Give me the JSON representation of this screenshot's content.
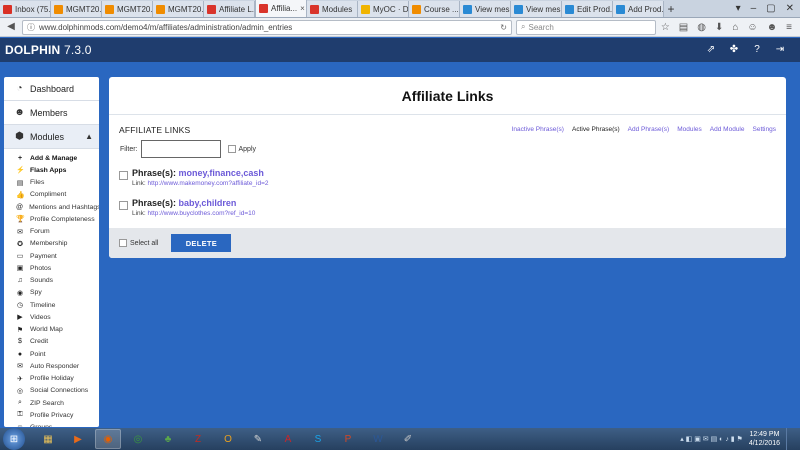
{
  "browser": {
    "tabs": [
      {
        "label": "Inbox (75...",
        "icon": "gmail-icon",
        "color": "#d93025"
      },
      {
        "label": "MGMT20...",
        "icon": "moodle-icon",
        "color": "#f08c00"
      },
      {
        "label": "MGMT20...",
        "icon": "moodle-icon",
        "color": "#f08c00"
      },
      {
        "label": "MGMT20...",
        "icon": "moodle-icon",
        "color": "#f08c00"
      },
      {
        "label": "Affiliate L...",
        "icon": "dolphin-icon",
        "color": "#d9342b"
      },
      {
        "label": "Affilia...",
        "icon": "dolphin-icon",
        "color": "#d9342b",
        "active": true
      },
      {
        "label": "Modules",
        "icon": "dolphin-icon",
        "color": "#d9342b"
      },
      {
        "label": "MyOC · D...",
        "icon": "star-icon",
        "color": "#f0b400"
      },
      {
        "label": "Course ...",
        "icon": "moodle-icon",
        "color": "#f08c00"
      },
      {
        "label": "View mes...",
        "icon": "chat-icon",
        "color": "#2a8ad4"
      },
      {
        "label": "View mes...",
        "icon": "chat-icon",
        "color": "#2a8ad4"
      },
      {
        "label": "Edit Prod...",
        "icon": "chat-icon",
        "color": "#2a8ad4"
      },
      {
        "label": "Add Prod...",
        "icon": "chat-icon",
        "color": "#2a8ad4"
      }
    ],
    "url": "www.dolphinmods.com/demo4/m/affiliates/administration/admin_entries",
    "search_placeholder": "Search"
  },
  "app": {
    "brand": "DOLPHIN",
    "version": "7.3.0"
  },
  "sidebar": {
    "dashboard": "Dashboard",
    "members": "Members",
    "modules": "Modules",
    "items": [
      {
        "label": "Add & Manage",
        "icon": "plus-icon",
        "glyph": "+",
        "bold": true
      },
      {
        "label": "Flash Apps",
        "icon": "lightning-icon",
        "glyph": "⚡",
        "bold": true
      },
      {
        "label": "Files",
        "icon": "file-icon",
        "glyph": "▤"
      },
      {
        "label": "Compliment",
        "icon": "thumbs-up-icon",
        "glyph": "👍"
      },
      {
        "label": "Mentions and Hashtags",
        "icon": "at-icon",
        "glyph": "@"
      },
      {
        "label": "Profile Completeness",
        "icon": "trophy-icon",
        "glyph": "🏆"
      },
      {
        "label": "Forum",
        "icon": "comments-icon",
        "glyph": "✉"
      },
      {
        "label": "Membership",
        "icon": "badge-icon",
        "glyph": "✪"
      },
      {
        "label": "Payment",
        "icon": "credit-card-icon",
        "glyph": "▭"
      },
      {
        "label": "Photos",
        "icon": "photo-icon",
        "glyph": "▣"
      },
      {
        "label": "Sounds",
        "icon": "music-icon",
        "glyph": "♫"
      },
      {
        "label": "Spy",
        "icon": "eye-icon",
        "glyph": "◉"
      },
      {
        "label": "Timeline",
        "icon": "clock-icon",
        "glyph": "◷"
      },
      {
        "label": "Videos",
        "icon": "film-icon",
        "glyph": "▶"
      },
      {
        "label": "World Map",
        "icon": "map-marker-icon",
        "glyph": "⚑"
      },
      {
        "label": "Credit",
        "icon": "money-icon",
        "glyph": "$"
      },
      {
        "label": "Point",
        "icon": "point-icon",
        "glyph": "●"
      },
      {
        "label": "Auto Responder",
        "icon": "envelope-icon",
        "glyph": "✉"
      },
      {
        "label": "Profile Holiday",
        "icon": "plane-icon",
        "glyph": "✈"
      },
      {
        "label": "Social Connections",
        "icon": "globe-icon",
        "glyph": "◎"
      },
      {
        "label": "ZIP Search",
        "icon": "search-icon",
        "glyph": "⌕"
      },
      {
        "label": "Profile Privacy",
        "icon": "key-icon",
        "glyph": "⚿"
      },
      {
        "label": "Groups",
        "icon": "users-icon",
        "glyph": "☺"
      }
    ]
  },
  "main": {
    "title": "Affiliate Links",
    "box_title": "AFFILIATE LINKS",
    "menu": [
      {
        "label": "Inactive Phrase(s)",
        "active": false
      },
      {
        "label": "Active Phrase(s)",
        "active": true
      },
      {
        "label": "Add Phrase(s)",
        "active": false
      },
      {
        "label": "Modules",
        "active": false
      },
      {
        "label": "Add Module",
        "active": false
      },
      {
        "label": "Settings",
        "active": false
      }
    ],
    "filter_label": "Filter:",
    "filter_value": "",
    "apply_label": "Apply",
    "entries": [
      {
        "phrase_label": "Phrase(s):",
        "phrase_value": "money,finance,cash",
        "link_label": "Link:",
        "link_url": "http://www.makemoney.com?affiliate_id=2"
      },
      {
        "phrase_label": "Phrase(s):",
        "phrase_value": "baby,children",
        "link_label": "Link:",
        "link_url": "http://www.buyclothes.com?ref_id=10"
      }
    ],
    "select_all_label": "Select all",
    "delete_label": "DELETE"
  },
  "taskbar": {
    "time": "12:49 PM",
    "date": "4/12/2016",
    "apps": [
      {
        "icon": "explorer-icon",
        "glyph": "▦",
        "color": "#e8c15a"
      },
      {
        "icon": "media-player-icon",
        "glyph": "▶",
        "color": "#e86a1a"
      },
      {
        "icon": "firefox-icon",
        "glyph": "◉",
        "color": "#e66000",
        "open": true
      },
      {
        "icon": "chrome-icon",
        "glyph": "◎",
        "color": "#3b9b3b"
      },
      {
        "icon": "game-icon",
        "glyph": "♣",
        "color": "#5aa84a"
      },
      {
        "icon": "filezilla-icon",
        "glyph": "Z",
        "color": "#bf2b22"
      },
      {
        "icon": "outlook-icon",
        "glyph": "O",
        "color": "#e8a020"
      },
      {
        "icon": "paint-icon",
        "glyph": "✎",
        "color": "#d5d5d5"
      },
      {
        "icon": "acrobat-icon",
        "glyph": "A",
        "color": "#c8262a"
      },
      {
        "icon": "skype-icon",
        "glyph": "S",
        "color": "#1aa3e8"
      },
      {
        "icon": "powerpoint-icon",
        "glyph": "P",
        "color": "#d24726"
      },
      {
        "icon": "word-icon",
        "glyph": "W",
        "color": "#2b5797"
      },
      {
        "icon": "tools-icon",
        "glyph": "✐",
        "color": "#c7c7c7"
      }
    ]
  }
}
